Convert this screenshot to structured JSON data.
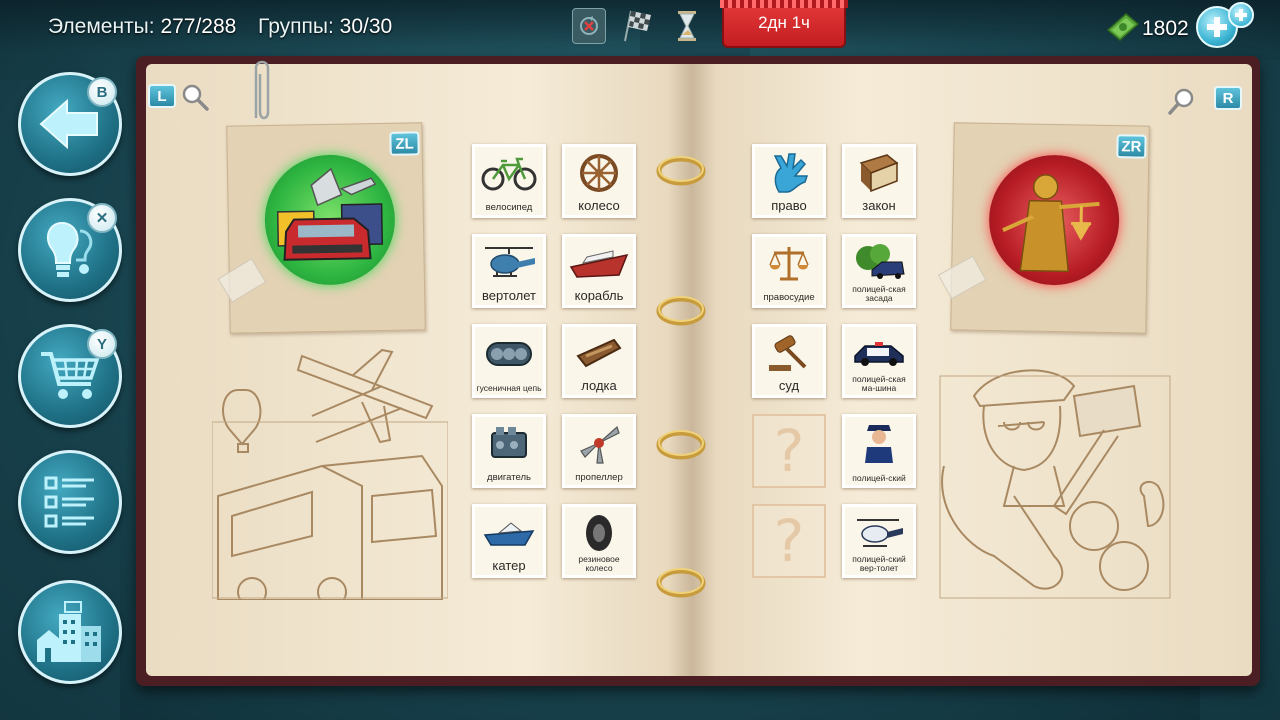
{
  "hud": {
    "elements_label": "Элементы:",
    "elements_value": "277/288",
    "groups_label": "Группы:",
    "groups_value": "30/30",
    "timer": "2дн 1ч",
    "currency": "1802"
  },
  "side_buttons": [
    {
      "name": "back",
      "badge": "B"
    },
    {
      "name": "hint",
      "badge": "✕"
    },
    {
      "name": "shop",
      "badge": "Y"
    },
    {
      "name": "list",
      "badge": ""
    },
    {
      "name": "city",
      "badge": ""
    }
  ],
  "book": {
    "left_tag": "L",
    "right_tag": "R",
    "left_group_tag": "ZL",
    "right_group_tag": "ZR",
    "left_elements": [
      {
        "label": "велосипед",
        "size": "small"
      },
      {
        "label": "колесо",
        "size": "big"
      },
      {
        "label": "вертолет",
        "size": "big"
      },
      {
        "label": "корабль",
        "size": "big"
      },
      {
        "label": "гусеничная цепь",
        "size": "tiny"
      },
      {
        "label": "лодка",
        "size": "big"
      },
      {
        "label": "двигатель",
        "size": "small"
      },
      {
        "label": "пропеллер",
        "size": "small"
      },
      {
        "label": "катер",
        "size": "big"
      },
      {
        "label": "резиновое колесо",
        "size": "tiny"
      }
    ],
    "right_elements": [
      {
        "label": "право",
        "size": "big"
      },
      {
        "label": "закон",
        "size": "big"
      },
      {
        "label": "правосудие",
        "size": "small"
      },
      {
        "label": "полицей-ская засада",
        "size": "tiny"
      },
      {
        "label": "суд",
        "size": "big"
      },
      {
        "label": "полицей-ская ма-шина",
        "size": "tiny"
      },
      {
        "label": "?",
        "size": "unknown"
      },
      {
        "label": "полицей-ский",
        "size": "tiny"
      },
      {
        "label": "?",
        "size": "unknown"
      },
      {
        "label": "полицей-ский вер-толет",
        "size": "tiny"
      }
    ]
  }
}
